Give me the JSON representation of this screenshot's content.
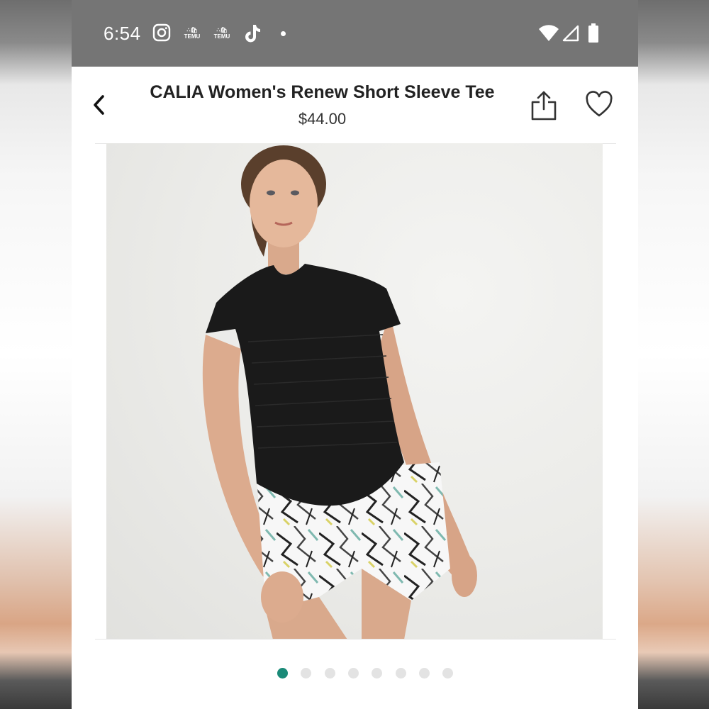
{
  "status_bar": {
    "time": "6:54",
    "notification_icons": [
      "instagram-icon",
      "temu-icon",
      "temu-icon",
      "tiktok-icon",
      "more-dot-icon"
    ],
    "temu_label": "TEMU",
    "system_icons": [
      "wifi-icon",
      "signal-icon",
      "battery-icon"
    ]
  },
  "header": {
    "back_icon": "chevron-left-icon",
    "title": "CALIA Women's Renew Short Sleeve Tee",
    "price": "$44.00",
    "share_icon": "share-icon",
    "favorite_icon": "heart-outline-icon"
  },
  "gallery": {
    "image_description": "Model wearing black short sleeve tee and white patterned shorts",
    "total_images": 8,
    "active_index": 0
  },
  "colors": {
    "status_bar_bg": "#757575",
    "accent": "#1a8a78",
    "inactive_dot": "#e3e3e3",
    "tee_black": "#1a1a1a"
  }
}
